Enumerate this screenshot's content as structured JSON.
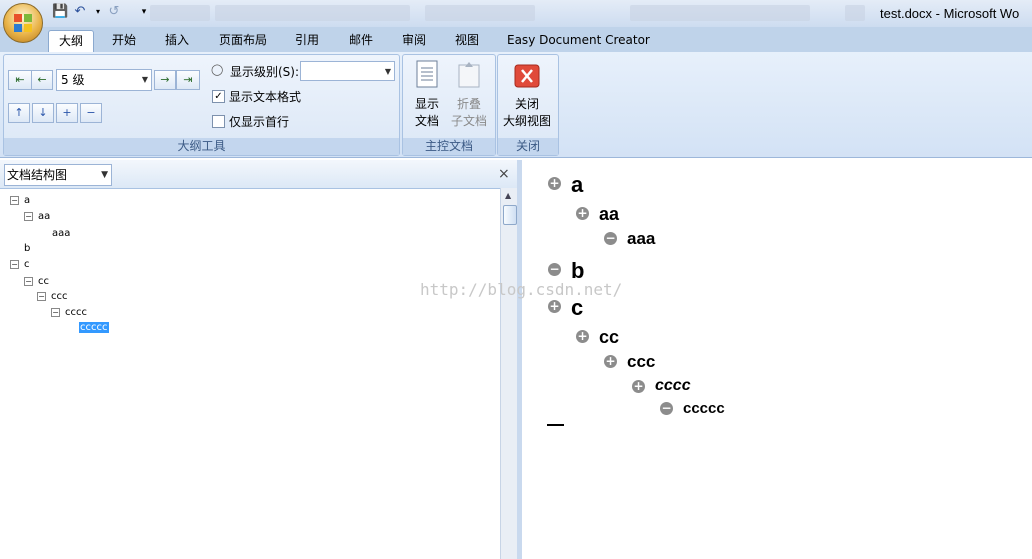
{
  "window": {
    "title": "test.docx - Microsoft Wo"
  },
  "tabs": [
    "大纲",
    "开始",
    "插入",
    "页面布局",
    "引用",
    "邮件",
    "审阅",
    "视图",
    "Easy Document Creator"
  ],
  "ribbon": {
    "outline_tools": {
      "level_value": "5 级",
      "show_level_label": "显示级别(S):",
      "show_level_value": "",
      "show_text_format_label": "显示文本格式",
      "show_first_line_label": "仅显示首行",
      "group_label": "大纲工具"
    },
    "master_doc": {
      "show_doc_label_1": "显示",
      "show_doc_label_2": "文档",
      "collapse_label_1": "折叠",
      "collapse_label_2": "子文档",
      "group_label": "主控文档"
    },
    "close": {
      "close_label_1": "关闭",
      "close_label_2": "大纲视图",
      "group_label": "关闭"
    }
  },
  "doc_map": {
    "view_select": "文档结构图",
    "items": [
      "a",
      "aa",
      "aaa",
      "b",
      "c",
      "cc",
      "ccc",
      "cccc",
      "ccccc"
    ]
  },
  "outline": {
    "items": [
      "a",
      "aa",
      "aaa",
      "b",
      "c",
      "cc",
      "ccc",
      "cccc",
      "ccccc"
    ],
    "watermark": "http://blog.csdn.net/"
  }
}
